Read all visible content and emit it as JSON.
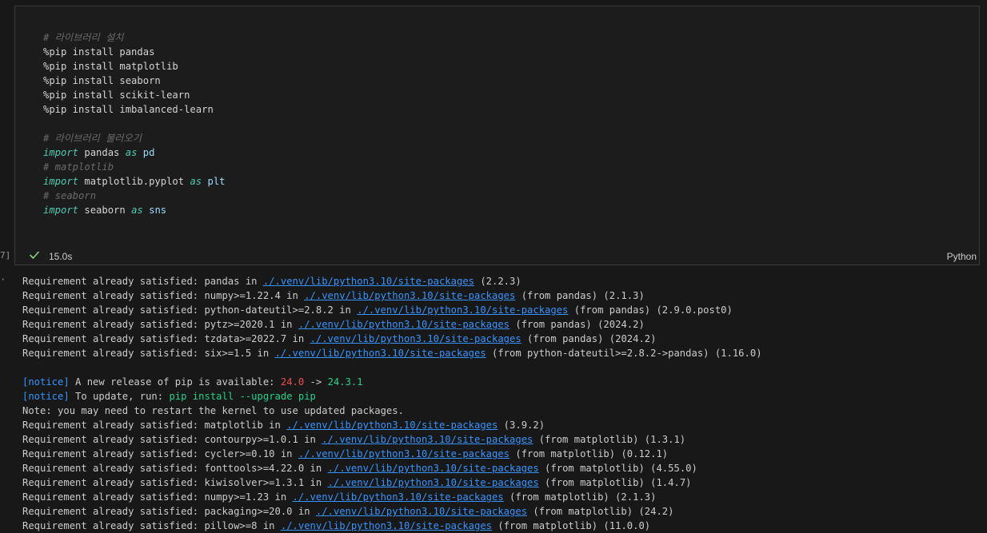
{
  "cell": {
    "code_lines": [
      {
        "type": "comment",
        "text": "# 라이브러리 설치"
      },
      {
        "type": "plain",
        "text": "%pip install pandas"
      },
      {
        "type": "plain",
        "text": "%pip install matplotlib"
      },
      {
        "type": "plain",
        "text": "%pip install seaborn"
      },
      {
        "type": "plain",
        "text": "%pip install scikit-learn"
      },
      {
        "type": "plain",
        "text": "%pip install imbalanced-learn"
      },
      {
        "type": "blank",
        "text": ""
      },
      {
        "type": "comment",
        "text": "# 라이브러리 불러오기"
      },
      {
        "type": "import",
        "kw": "import",
        "mod": "pandas",
        "as": "as",
        "alias": "pd"
      },
      {
        "type": "comment",
        "text": "# matplotlib"
      },
      {
        "type": "import",
        "kw": "import",
        "mod": "matplotlib.pyplot",
        "as": "as",
        "alias": "plt"
      },
      {
        "type": "comment",
        "text": "# seaborn"
      },
      {
        "type": "import",
        "kw": "import",
        "mod": "seaborn",
        "as": "as",
        "alias": "sns"
      }
    ],
    "exec_count": "7]",
    "duration": "15.0s",
    "language": "Python"
  },
  "output": {
    "marker": "·",
    "lines": [
      {
        "type": "req",
        "pre": "Requirement already satisfied: pandas in ",
        "link": "./.venv/lib/python3.10/site-packages",
        "post": " (2.2.3)"
      },
      {
        "type": "req",
        "pre": "Requirement already satisfied: numpy>=1.22.4 in ",
        "link": "./.venv/lib/python3.10/site-packages",
        "post": " (from pandas) (2.1.3)"
      },
      {
        "type": "req",
        "pre": "Requirement already satisfied: python-dateutil>=2.8.2 in ",
        "link": "./.venv/lib/python3.10/site-packages",
        "post": " (from pandas) (2.9.0.post0)"
      },
      {
        "type": "req",
        "pre": "Requirement already satisfied: pytz>=2020.1 in ",
        "link": "./.venv/lib/python3.10/site-packages",
        "post": " (from pandas) (2024.2)"
      },
      {
        "type": "req",
        "pre": "Requirement already satisfied: tzdata>=2022.7 in ",
        "link": "./.venv/lib/python3.10/site-packages",
        "post": " (from pandas) (2024.2)"
      },
      {
        "type": "req",
        "pre": "Requirement already satisfied: six>=1.5 in ",
        "link": "./.venv/lib/python3.10/site-packages",
        "post": " (from python-dateutil>=2.8.2->pandas) (1.16.0)"
      },
      {
        "type": "blank"
      },
      {
        "type": "notice1",
        "tag": "[notice]",
        "text": " A new release of pip is available: ",
        "old": "24.0",
        "arrow": " -> ",
        "new": "24.3.1"
      },
      {
        "type": "notice2",
        "tag": "[notice]",
        "text": " To update, run: ",
        "cmd": "pip install --upgrade pip"
      },
      {
        "type": "text",
        "text": "Note: you may need to restart the kernel to use updated packages."
      },
      {
        "type": "req",
        "pre": "Requirement already satisfied: matplotlib in ",
        "link": "./.venv/lib/python3.10/site-packages",
        "post": " (3.9.2)"
      },
      {
        "type": "req",
        "pre": "Requirement already satisfied: contourpy>=1.0.1 in ",
        "link": "./.venv/lib/python3.10/site-packages",
        "post": " (from matplotlib) (1.3.1)"
      },
      {
        "type": "req",
        "pre": "Requirement already satisfied: cycler>=0.10 in ",
        "link": "./.venv/lib/python3.10/site-packages",
        "post": " (from matplotlib) (0.12.1)"
      },
      {
        "type": "req",
        "pre": "Requirement already satisfied: fonttools>=4.22.0 in ",
        "link": "./.venv/lib/python3.10/site-packages",
        "post": " (from matplotlib) (4.55.0)"
      },
      {
        "type": "req",
        "pre": "Requirement already satisfied: kiwisolver>=1.3.1 in ",
        "link": "./.venv/lib/python3.10/site-packages",
        "post": " (from matplotlib) (1.4.7)"
      },
      {
        "type": "req",
        "pre": "Requirement already satisfied: numpy>=1.23 in ",
        "link": "./.venv/lib/python3.10/site-packages",
        "post": " (from matplotlib) (2.1.3)"
      },
      {
        "type": "req",
        "pre": "Requirement already satisfied: packaging>=20.0 in ",
        "link": "./.venv/lib/python3.10/site-packages",
        "post": " (from matplotlib) (24.2)"
      },
      {
        "type": "req",
        "pre": "Requirement already satisfied: pillow>=8 in ",
        "link": "./.venv/lib/python3.10/site-packages",
        "post": " (from matplotlib) (11.0.0)"
      }
    ]
  },
  "colors": {
    "background": "#181818",
    "keyword": "#4ec9b0",
    "link": "#3794ff",
    "success_check": "#89d185",
    "old_version": "#f14c4c",
    "new_version": "#23d18b"
  },
  "icons": {
    "status": "check-icon"
  }
}
